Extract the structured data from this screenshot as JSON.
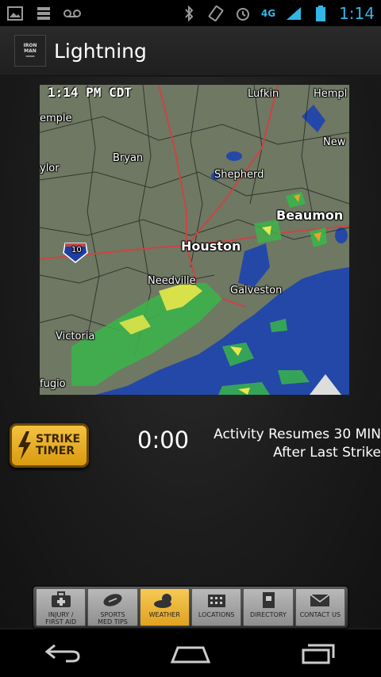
{
  "status_bar": {
    "time": "1:14",
    "network": "4G",
    "icons": [
      "image-icon",
      "storage-icon",
      "voicemail-icon",
      "bluetooth-icon",
      "rotate-icon",
      "alarm-icon",
      "signal-icon",
      "battery-icon"
    ]
  },
  "header": {
    "title": "Lightning",
    "logo_icon": "ironman-logo-icon"
  },
  "map": {
    "timestamp": "1:14 PM CDT",
    "labels": {
      "lufkin": "Lufkin",
      "hempl": "Hempl",
      "temple": "emple",
      "bryan": "Bryan",
      "taylor": "ylor",
      "new": "New",
      "shepherd": "Shepherd",
      "beaumont": "Beaumon",
      "houston": "Houston",
      "needville": "Needville",
      "galveston": "Galveston",
      "victoria": "Victoria",
      "refugio": "fugio",
      "interstate": "10"
    }
  },
  "timer": {
    "button_line1": "STRIKE",
    "button_line2": "TIMER",
    "value": "0:00",
    "resume_line1": "Activity Resumes 30 MIN",
    "resume_line2": "After Last Strike"
  },
  "tabs": [
    {
      "label1": "INJURY /",
      "label2": "FIRST AID",
      "icon": "first-aid-kit-icon"
    },
    {
      "label1": "SPORTS",
      "label2": "MED TIPS",
      "icon": "football-icon"
    },
    {
      "label1": "WEATHER",
      "label2": "",
      "icon": "weather-icon"
    },
    {
      "label1": "LOCATIONS",
      "label2": "",
      "icon": "building-icon"
    },
    {
      "label1": "DIRECTORY",
      "label2": "",
      "icon": "book-icon"
    },
    {
      "label1": "CONTACT US",
      "label2": "",
      "icon": "envelope-icon"
    }
  ],
  "colors": {
    "accent_blue": "#33b5e5",
    "active_tab": "#f0b83a",
    "strike_button": "#e8ae22"
  }
}
